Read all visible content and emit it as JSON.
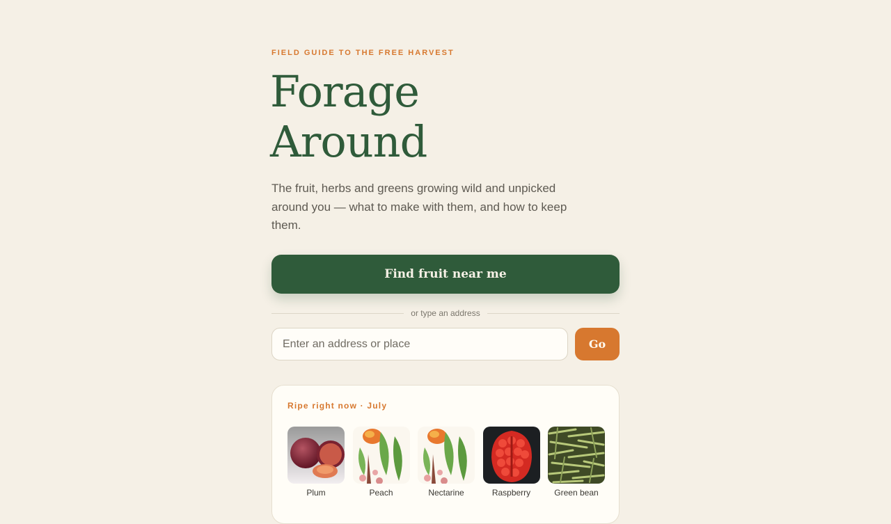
{
  "hero": {
    "eyebrow": "FIELD GUIDE TO THE FREE HARVEST",
    "title_line1": "Forage",
    "title_line2": "Around",
    "lede": "The fruit, herbs and greens growing wild and unpicked around you — what to make with them, and how to keep them."
  },
  "actions": {
    "find_label": "Find fruit near me",
    "divider_text": "or type an address",
    "address_placeholder": "Enter an address or place",
    "address_value": "",
    "go_label": "Go"
  },
  "ripe": {
    "title": "Ripe right now · July",
    "items": [
      {
        "label": "Plum",
        "icon": "plum-image"
      },
      {
        "label": "Peach",
        "icon": "peach-illustration"
      },
      {
        "label": "Nectarine",
        "icon": "nectarine-illustration"
      },
      {
        "label": "Raspberry",
        "icon": "raspberry-image"
      },
      {
        "label": "Green bean",
        "icon": "green-bean-image"
      }
    ]
  },
  "colors": {
    "background": "#f5f0e6",
    "forest_green": "#2f5b3a",
    "orange_accent": "#d7782f",
    "card": "#fffdf7"
  }
}
